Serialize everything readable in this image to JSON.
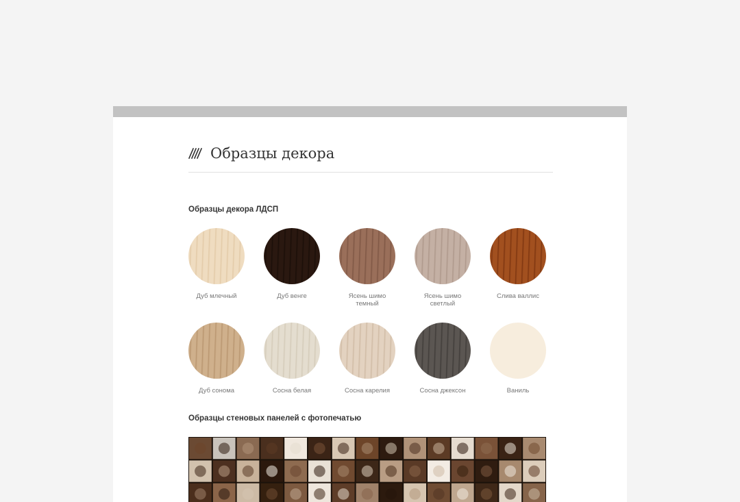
{
  "page": {
    "title": "Образцы декора"
  },
  "sections": {
    "ldsp_title": "Образцы декора ЛДСП",
    "panels_title": "Образцы стеновых панелей с фотопечатью"
  },
  "swatches": [
    {
      "label": "Дуб млечный",
      "base": "#efdcc0",
      "grain": "#e2c9a6"
    },
    {
      "label": "Дуб венге",
      "base": "#2a1810",
      "grain": "#1a0e08"
    },
    {
      "label": "Ясень шимо темный",
      "base": "#9a6f5a",
      "grain": "#7e5644"
    },
    {
      "label": "Ясень шимо светлый",
      "base": "#c4b0a4",
      "grain": "#ad978a"
    },
    {
      "label": "Слива валлис",
      "base": "#a2501f",
      "grain": "#7d3510"
    },
    {
      "label": "Дуб сонома",
      "base": "#cfb08c",
      "grain": "#b8956f"
    },
    {
      "label": "Сосна белая",
      "base": "#e4ddcf",
      "grain": "#d3cab8"
    },
    {
      "label": "Сосна карелия",
      "base": "#e3d2c0",
      "grain": "#cfbaa4"
    },
    {
      "label": "Сосна джексон",
      "base": "#5b5652",
      "grain": "#403c39"
    },
    {
      "label": "Ваниль",
      "base": "#f7eddd",
      "grain": "#f7eddd"
    }
  ],
  "panel_tiles": [
    "#6b4a33",
    "#c9c3bb",
    "#8a6a52",
    "#4a2f1e",
    "#f0e8de",
    "#3b2416",
    "#d8c8b4",
    "#6d4529",
    "#2e1b10",
    "#b09278",
    "#5c3b25",
    "#e6dcd0",
    "#7a5238",
    "#3a2315",
    "#a88a70",
    "#d2c2ae",
    "#4d3020",
    "#c8b29a",
    "#2b180d",
    "#8e6b50",
    "#e9e1d6",
    "#704a30",
    "#3d2718",
    "#b99d84",
    "#5a3a26",
    "#f3ece4",
    "#6a4630",
    "#2f1c10",
    "#a7896e",
    "#dccdbb",
    "#4b2e1c",
    "#8b6549",
    "#cdbba6",
    "#35200f",
    "#7d5a40",
    "#eee6dc",
    "#5e3d28",
    "#a0826a",
    "#2c1a0e",
    "#d6c5b0",
    "#6f4c33",
    "#bfa78f",
    "#3f2818",
    "#e4d8ca",
    "#86644a",
    "#26160b",
    "#b49980",
    "#523523",
    "#f1e9df",
    "#7b573c",
    "#3a2415",
    "#cbb8a2",
    "#66432b",
    "#9a7b61",
    "#2d1b0f",
    "#e0d2c2",
    "#584029",
    "#ad9278",
    "#322010",
    "#efe6da",
    "#7e5d43",
    "#c4ad96",
    "#472c1b",
    "#8f6f55",
    "#dbcbb8",
    "#2a190c",
    "#a58a70",
    "#5f3f29",
    "#ebe2d7",
    "#3c2616"
  ]
}
